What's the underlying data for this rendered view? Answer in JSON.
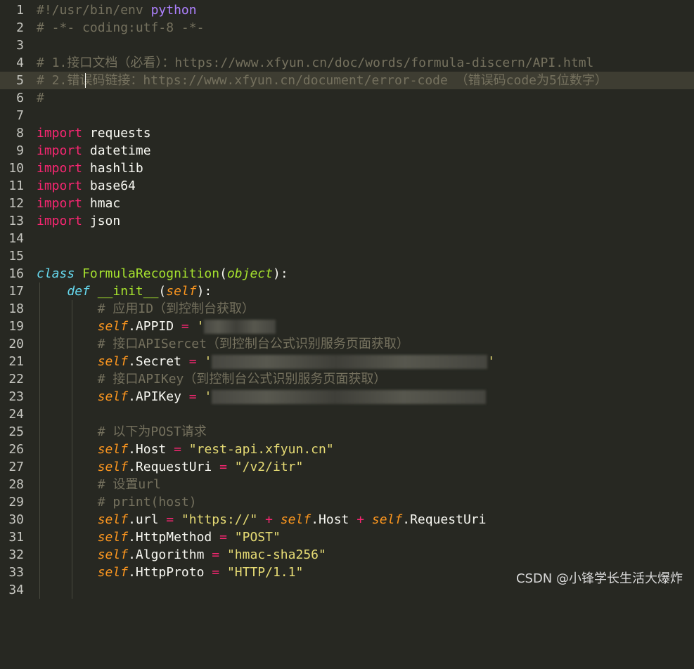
{
  "editor": {
    "language": "python",
    "theme": "monokai",
    "active_line": 5,
    "colors": {
      "background": "#272822",
      "comment": "#75715e",
      "keyword": "#f92672",
      "string": "#e6db74",
      "class_name": "#a6e22e",
      "self": "#fd971f",
      "builtin": "#66d9ef"
    },
    "lines": {
      "l1": {
        "num": "1",
        "a": "#!/usr/bin/env ",
        "b": "python"
      },
      "l2": {
        "num": "2",
        "a": "# -*- coding:utf-8 -*-"
      },
      "l3": {
        "num": "3"
      },
      "l4": {
        "num": "4",
        "a": "# 1.接口文档（必看）：https://www.xfyun.cn/doc/words/formula-discern/API.html"
      },
      "l5": {
        "num": "5",
        "a": "# 2.错误码链接：https://www.xfyun.cn/document/error-code （错误码code为5位数字）"
      },
      "l6": {
        "num": "6",
        "a": "#"
      },
      "l7": {
        "num": "7"
      },
      "l8": {
        "num": "8",
        "kw": "import",
        "rest": " requests"
      },
      "l9": {
        "num": "9",
        "kw": "import",
        "rest": " datetime"
      },
      "l10": {
        "num": "10",
        "kw": "import",
        "rest": " hashlib"
      },
      "l11": {
        "num": "11",
        "kw": "import",
        "rest": " base64"
      },
      "l12": {
        "num": "12",
        "kw": "import",
        "rest": " hmac"
      },
      "l13": {
        "num": "13",
        "kw": "import",
        "rest": " json"
      },
      "l14": {
        "num": "14"
      },
      "l15": {
        "num": "15"
      },
      "l16": {
        "num": "16",
        "kw": "class",
        "name": "FormulaRecognition",
        "p1": "(",
        "base": "object",
        "p2": "):"
      },
      "l17": {
        "num": "17",
        "kw": "def",
        "name": "__init__",
        "p1": "(",
        "self": "self",
        "p2": "):"
      },
      "l18": {
        "num": "18",
        "a": "# 应用ID（到控制台获取）"
      },
      "l19": {
        "num": "19",
        "self": "self",
        "attr": ".APPID",
        "op": " = ",
        "q": "'"
      },
      "l20": {
        "num": "20",
        "a": "# 接口APISercet（到控制台公式识别服务页面获取）"
      },
      "l21": {
        "num": "21",
        "self": "self",
        "attr": ".Secret",
        "op": " = ",
        "q": "'"
      },
      "l22": {
        "num": "22",
        "a": "# 接口APIKey（到控制台公式识别服务页面获取）"
      },
      "l23": {
        "num": "23",
        "self": "self",
        "attr": ".APIKey",
        "op": " = ",
        "q": "'"
      },
      "l24": {
        "num": "24"
      },
      "l25": {
        "num": "25",
        "a": "# 以下为POST请求"
      },
      "l26": {
        "num": "26",
        "self": "self",
        "attr": ".Host",
        "op": " = ",
        "str": "\"rest-api.xfyun.cn\""
      },
      "l27": {
        "num": "27",
        "self": "self",
        "attr": ".RequestUri",
        "op": " = ",
        "str": "\"/v2/itr\""
      },
      "l28": {
        "num": "28",
        "a": "# 设置url"
      },
      "l29": {
        "num": "29",
        "a": "# print(host)"
      },
      "l30": {
        "num": "30",
        "self": "self",
        "attr": ".url",
        "op": " = ",
        "str": "\"https://\"",
        "op2": " + ",
        "self2": "self",
        "attr2": ".Host",
        "op3": " + ",
        "self3": "self",
        "attr3": ".RequestUri"
      },
      "l31": {
        "num": "31",
        "self": "self",
        "attr": ".HttpMethod",
        "op": " = ",
        "str": "\"POST\""
      },
      "l32": {
        "num": "32",
        "self": "self",
        "attr": ".Algorithm",
        "op": " = ",
        "str": "\"hmac-sha256\""
      },
      "l33": {
        "num": "33",
        "self": "self",
        "attr": ".HttpProto",
        "op": " = ",
        "str": "\"HTTP/1.1\""
      },
      "l34": {
        "num": "34"
      }
    }
  },
  "watermark": "CSDN @小锋学长生活大爆炸"
}
